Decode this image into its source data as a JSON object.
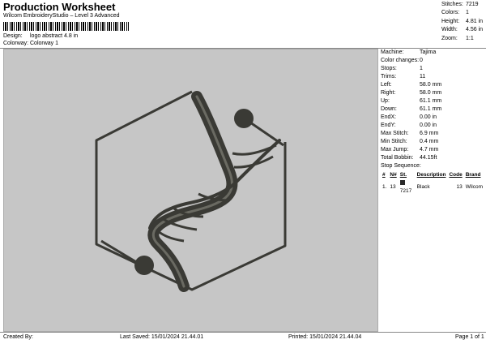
{
  "header": {
    "title": "Production Worksheet",
    "subtitle": "Wilcom EmbroideryStudio – Level 3 Advanced",
    "design_label": "Design:",
    "design_value": "logo abstract 4.8 in",
    "colorway_label": "Colorway:",
    "colorway_value": "Colorway 1"
  },
  "stats": {
    "stitches_label": "Stitches:",
    "stitches": "7219",
    "colors_label": "Colors:",
    "colors": "1",
    "height_label": "Height:",
    "height": "4.81 in",
    "width_label": "Width:",
    "width": "4.56 in",
    "zoom_label": "Zoom:",
    "zoom": "1:1"
  },
  "info": {
    "machine_label": "Machine:",
    "machine": "Tajima",
    "color_changes_label": "Color changes:",
    "color_changes": "0",
    "stops_label": "Stops:",
    "stops": "1",
    "trims_label": "Trims:",
    "trims": "11",
    "left_label": "Left:",
    "left": "58.0 mm",
    "right_label": "Right:",
    "right": "58.0 mm",
    "up_label": "Up:",
    "up": "61.1 mm",
    "down_label": "Down:",
    "down": "61.1 mm",
    "endx_label": "EndX:",
    "endx": "0.00 in",
    "endy_label": "EndY:",
    "endy": "0.00 in",
    "max_stitch_label": "Max Stitch:",
    "max_stitch": "6.9 mm",
    "min_stitch_label": "Min Stitch:",
    "min_stitch": "0.4 mm",
    "max_jump_label": "Max Jump:",
    "max_jump": "4.7 mm",
    "total_bobbin_label": "Total Bobbin:",
    "total_bobbin": "44.15ft"
  },
  "stop_sequence": {
    "title": "Stop Sequence:",
    "columns": [
      "#",
      "N#",
      "St.",
      "Description",
      "Code",
      "Brand"
    ],
    "row": {
      "num": "1.",
      "needle": "13",
      "stitches": "7217",
      "description": "Black",
      "code": "13",
      "brand": "Wilcom"
    },
    "swatch_color": "#2a2a2a"
  },
  "footer": {
    "created_by": "Created By:",
    "last_saved": "Last Saved: 15/01/2024 21.44.01",
    "printed": "Printed: 15/01/2024 21.44.04",
    "page": "Page 1 of 1"
  },
  "colors": {
    "canvas_bg": "#c6c6c6",
    "thread": "#3a3a35"
  }
}
